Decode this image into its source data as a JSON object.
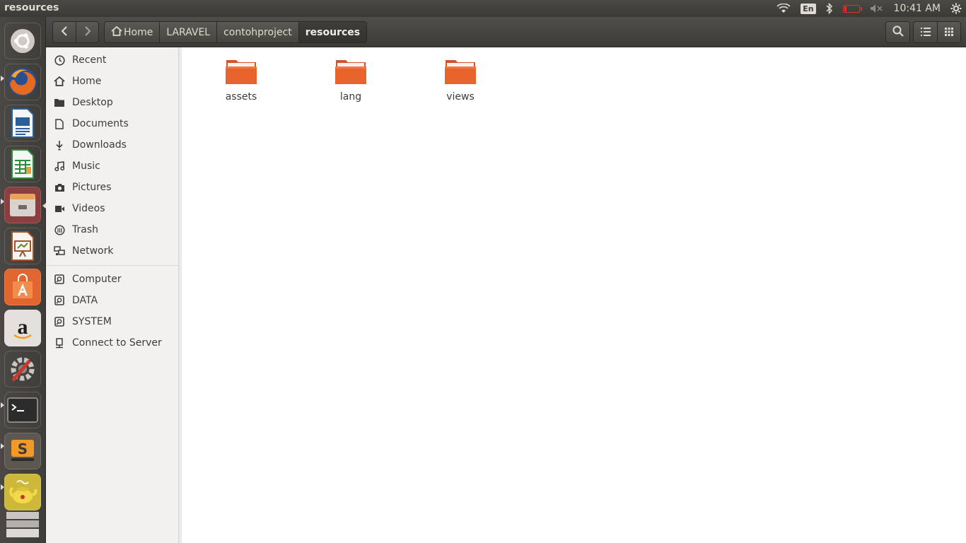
{
  "window": {
    "title": "resources"
  },
  "top_panel": {
    "indicators": [
      {
        "name": "wifi-icon"
      },
      {
        "name": "keyboard-layout",
        "label": "En"
      },
      {
        "name": "bluetooth-icon"
      },
      {
        "name": "battery-icon",
        "level_fraction": 0.15
      },
      {
        "name": "volume-muted-icon"
      }
    ],
    "clock": "10:41 AM",
    "settings_icon": "gear-icon"
  },
  "launcher": {
    "items": [
      {
        "name": "ubuntu-dash",
        "color": "#7a7673"
      },
      {
        "name": "firefox",
        "color": "#c85a1c"
      },
      {
        "name": "libreoffice-writer",
        "color": "#2b5f9a"
      },
      {
        "name": "libreoffice-calc",
        "color": "#2f8a3c"
      },
      {
        "name": "files",
        "color": "#a84545"
      },
      {
        "name": "libreoffice-impress",
        "color": "#a3542a"
      },
      {
        "name": "ubuntu-software-center",
        "color": "#e0652e"
      },
      {
        "name": "amazon",
        "color": "#d9d6d2"
      },
      {
        "name": "system-settings",
        "color": "#5a5753"
      },
      {
        "name": "terminal",
        "color": "#2c2c2c"
      },
      {
        "name": "sublime-text",
        "color": "#c07a2e"
      },
      {
        "name": "apache-tomcat",
        "color": "#c3b13a"
      },
      {
        "name": "workspace-switcher",
        "color": "#8b8884"
      }
    ]
  },
  "toolbar": {
    "back_icon": "chevron-left-icon",
    "forward_icon": "chevron-right-icon",
    "breadcrumbs": [
      "Home",
      "LARAVEL",
      "contohproject",
      "resources"
    ],
    "search_icon": "search-icon",
    "list_view_icon": "list-view-icon",
    "grid_view_icon": "grid-view-icon"
  },
  "sidebar": {
    "places": [
      {
        "label": "Recent",
        "icon": "clock-icon"
      },
      {
        "label": "Home",
        "icon": "home-icon"
      },
      {
        "label": "Desktop",
        "icon": "desktop-folder-icon"
      },
      {
        "label": "Documents",
        "icon": "document-icon"
      },
      {
        "label": "Downloads",
        "icon": "download-icon"
      },
      {
        "label": "Music",
        "icon": "music-note-icon"
      },
      {
        "label": "Pictures",
        "icon": "camera-icon"
      },
      {
        "label": "Videos",
        "icon": "video-icon"
      },
      {
        "label": "Trash",
        "icon": "trash-icon"
      },
      {
        "label": "Network",
        "icon": "network-icon"
      }
    ],
    "devices": [
      {
        "label": "Computer",
        "icon": "drive-icon"
      },
      {
        "label": "DATA",
        "icon": "drive-icon"
      },
      {
        "label": "SYSTEM",
        "icon": "drive-icon"
      },
      {
        "label": "Connect to Server",
        "icon": "server-icon"
      }
    ]
  },
  "content": {
    "folders": [
      {
        "label": "assets"
      },
      {
        "label": "lang"
      },
      {
        "label": "views"
      }
    ],
    "folder_color": "#e8642c"
  }
}
